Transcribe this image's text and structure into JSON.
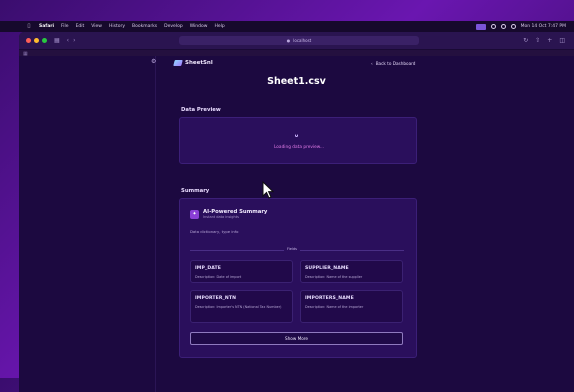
{
  "menubar": {
    "app": "Safari",
    "items": [
      "File",
      "Edit",
      "View",
      "History",
      "Bookmarks",
      "Develop",
      "Window",
      "Help"
    ],
    "clock": "Mon 14 Oct  7:47 PM"
  },
  "browser": {
    "url": "localhost"
  },
  "app": {
    "brand": "SheetSnl",
    "back_label": "Back to Dashboard",
    "page_title": "Sheet1.csv"
  },
  "preview": {
    "heading": "Data Preview",
    "loading_text": "Loading data preview..."
  },
  "summary": {
    "heading": "Summary",
    "ai_title": "AI-Powered Summary",
    "ai_subtitle": "Instant data insights",
    "description": "Data dictionary, type info",
    "fields_label": "Fields",
    "fields": [
      {
        "name": "IMP_DATE",
        "description": "Description: Date of import"
      },
      {
        "name": "SUPPLIER_NAME",
        "description": "Description: Name of the supplier"
      },
      {
        "name": "IMPORTER_NTN",
        "description": "Description: Importer's NTN (National Tax Number)"
      },
      {
        "name": "IMPORTERS_NAME",
        "description": "Description: Name of the importer"
      }
    ],
    "show_more": "Show More"
  },
  "icons": {
    "settings": "gear-icon",
    "back": "chevron-left-icon",
    "ai": "sparkle-icon",
    "cursor": "pointer-arrow-icon"
  },
  "colors": {
    "accent_pink": "#e37ce8",
    "card_bg": "#2a0f5c",
    "page_bg": "#1c0940"
  }
}
